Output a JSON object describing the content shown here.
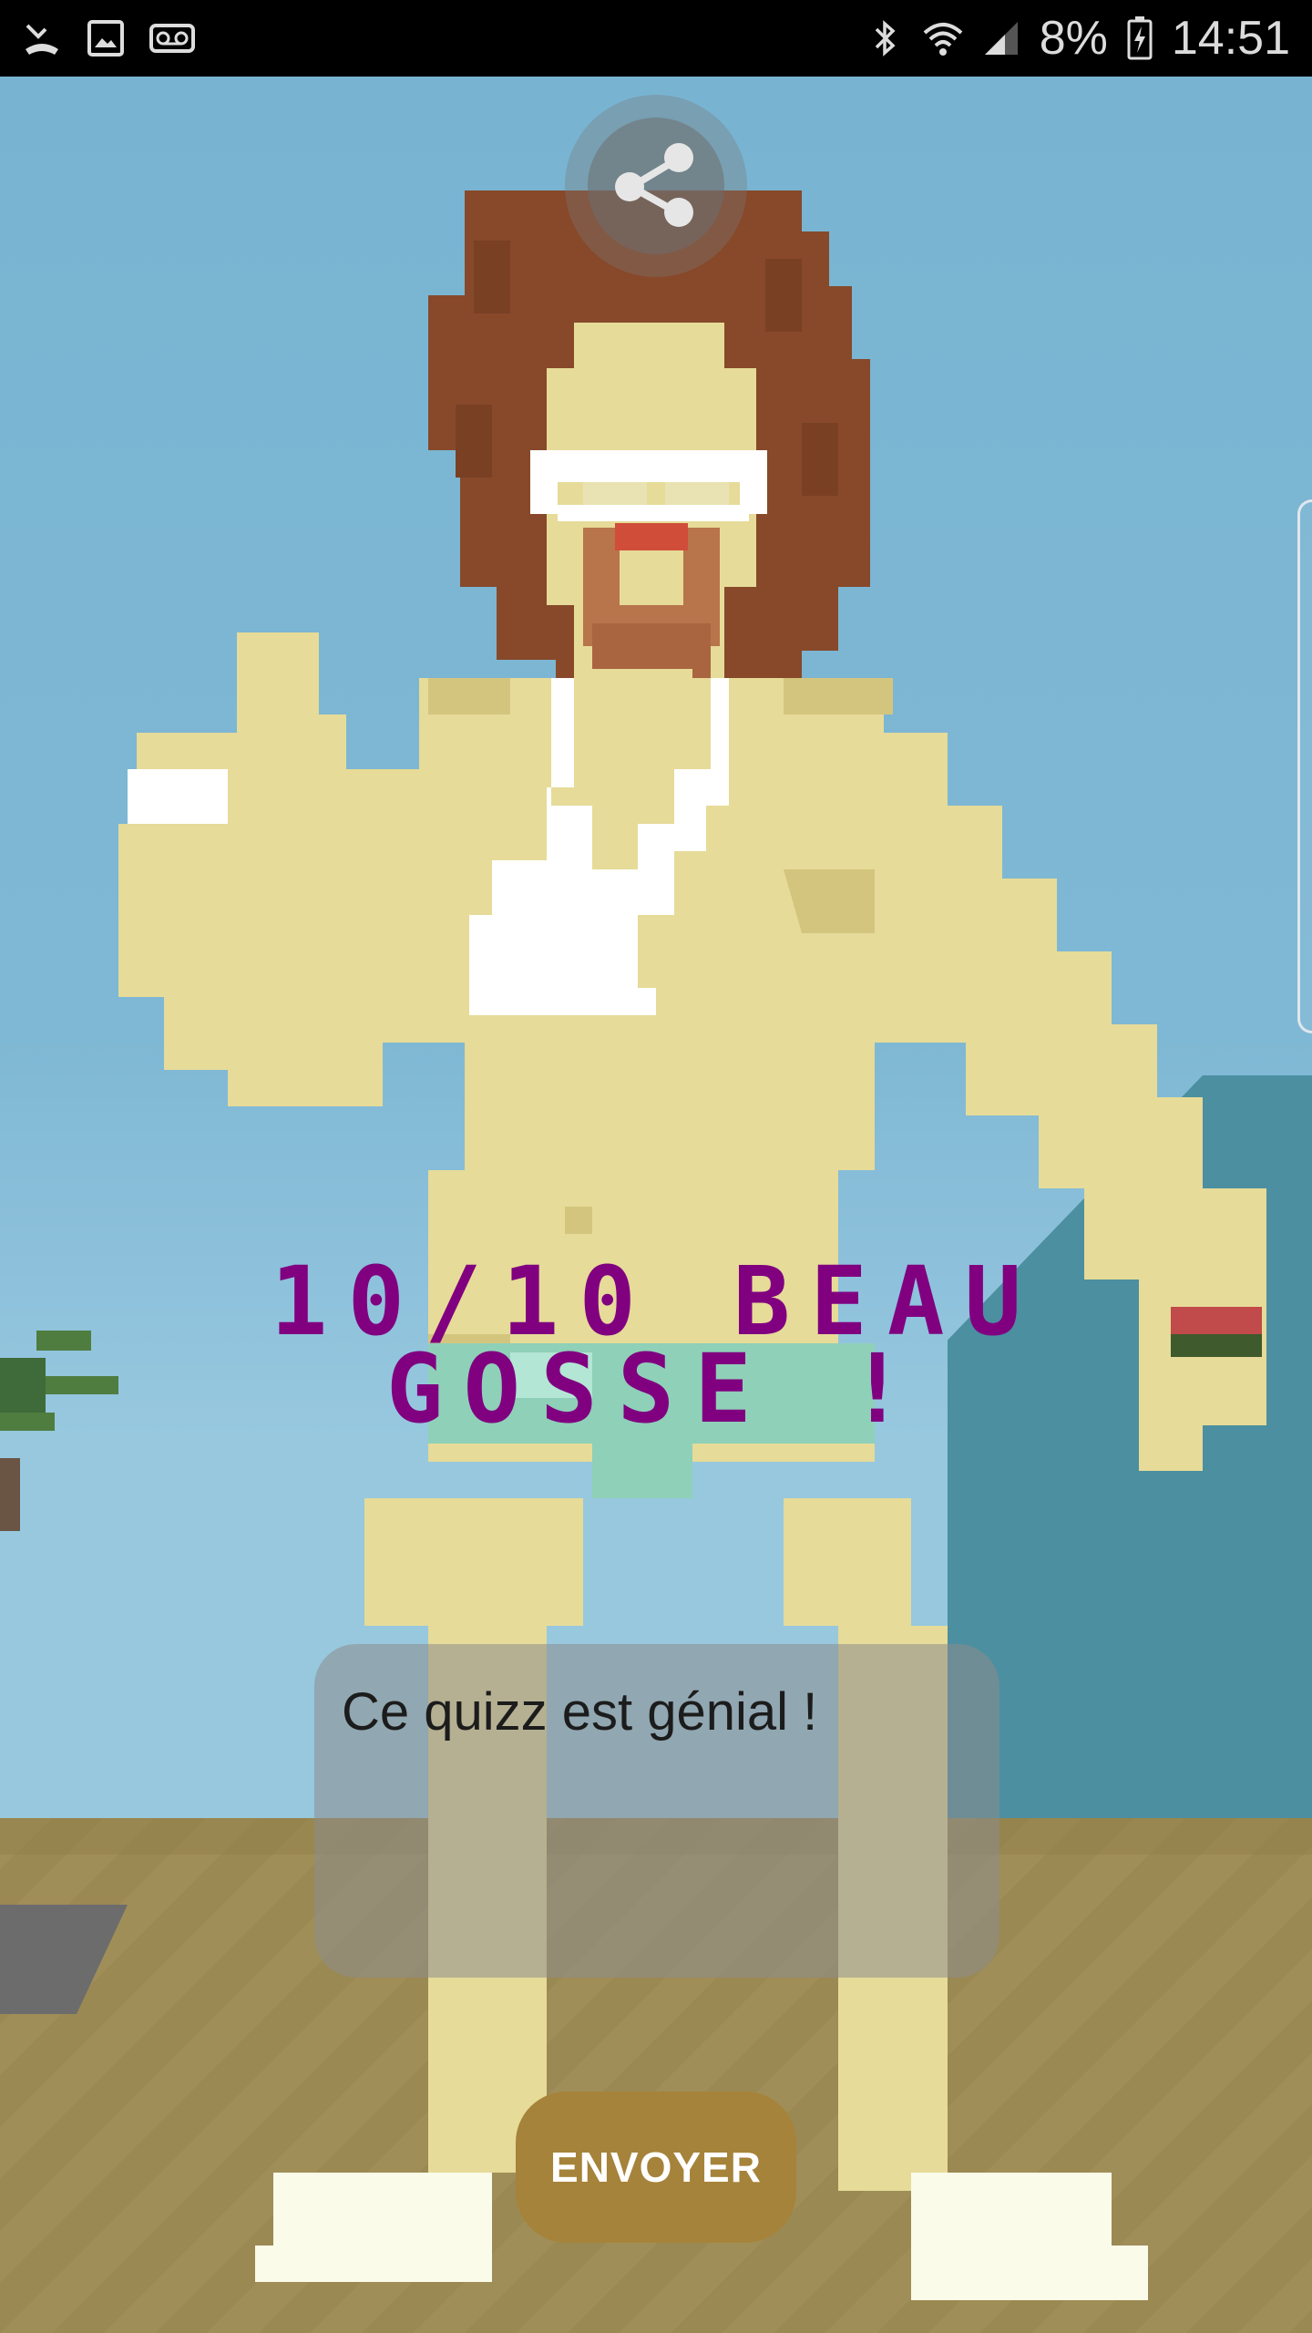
{
  "status_bar": {
    "time": "14:51",
    "battery": "8%",
    "left_icons": [
      "missed-call-icon",
      "image-icon",
      "voicemail-icon"
    ],
    "right_icons": [
      "bluetooth-icon",
      "wifi-icon",
      "signal-icon",
      "battery-charging-icon"
    ]
  },
  "share": {
    "icon": "share-icon"
  },
  "result": {
    "line1": "10/10 BEAU",
    "line2": "GOSSE !",
    "color": "#800080"
  },
  "comment": {
    "value": "Ce quizz est génial !"
  },
  "send": {
    "label": "ENVOYER",
    "color": "#a6833a"
  }
}
